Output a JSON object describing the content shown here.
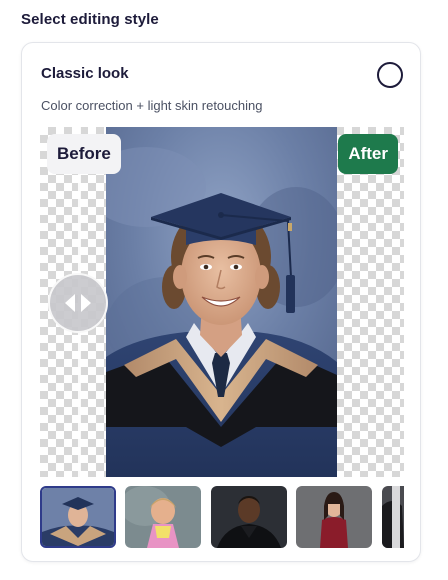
{
  "section": {
    "title": "Select editing style"
  },
  "option": {
    "title": "Classic look",
    "description": "Color correction + light skin retouching",
    "selected": false
  },
  "comparison": {
    "before_label": "Before",
    "after_label": "After",
    "slider_icon": "arrows-left-right-icon",
    "colors": {
      "after_badge": "#1e7a4c",
      "before_badge": "#f3f3f5"
    }
  },
  "thumbnails": [
    {
      "subject": "graduate in navy cap and gown",
      "selected": true
    },
    {
      "subject": "young girl in pink dress",
      "selected": false
    },
    {
      "subject": "man in black leather jacket",
      "selected": false
    },
    {
      "subject": "woman in red dress",
      "selected": false
    },
    {
      "subject": "partial portrait",
      "selected": false
    }
  ]
}
